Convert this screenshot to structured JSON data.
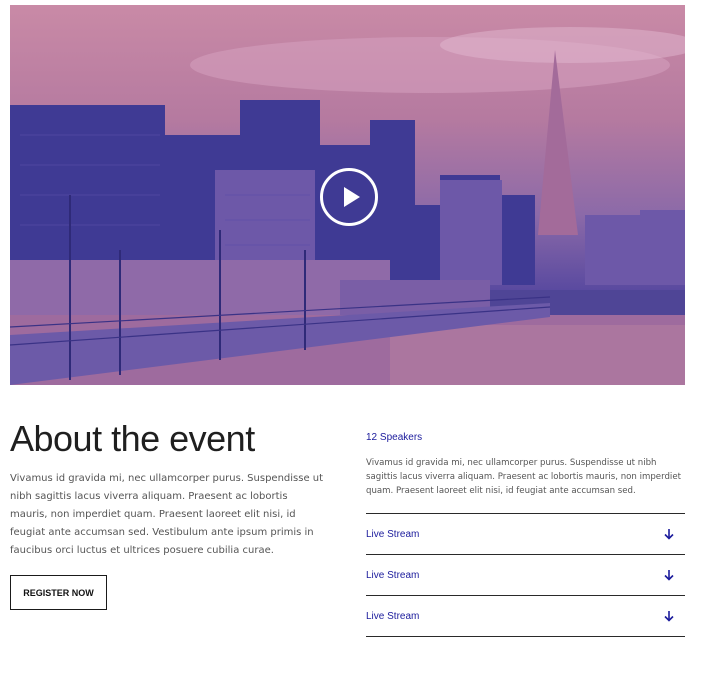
{
  "hero": {
    "play_label": ""
  },
  "about": {
    "title": "About the event",
    "text": "Vivamus id gravida mi, nec ullamcorper purus. Suspendisse ut nibh sagittis lacus viverra aliquam. Praesent ac lobortis mauris, non imperdiet quam. Praesent laoreet elit nisi, id feugiat ante accumsan sed. Vestibulum ante ipsum primis in faucibus orci luctus et ultrices posuere cubilia curae.",
    "register_label": "REGISTER NOW"
  },
  "speakers": {
    "label": "12 Speakers",
    "text": "Vivamus id gravida mi, nec ullamcorper purus. Suspendisse ut nibh sagittis lacus viverra aliquam. Praesent ac lobortis mauris, non imperdiet quam. Praesent laoreet elit nisi, id feugiat ante accumsan sed."
  },
  "accordion": [
    {
      "label": "Live Stream",
      "icon": "arrow-down-icon"
    },
    {
      "label": "Live Stream",
      "icon": "arrow-down-icon"
    },
    {
      "label": "Live Stream",
      "icon": "arrow-down-icon"
    }
  ],
  "colors": {
    "accent": "#1b1b9c",
    "text": "#555555",
    "heading": "#1f1f1f"
  }
}
